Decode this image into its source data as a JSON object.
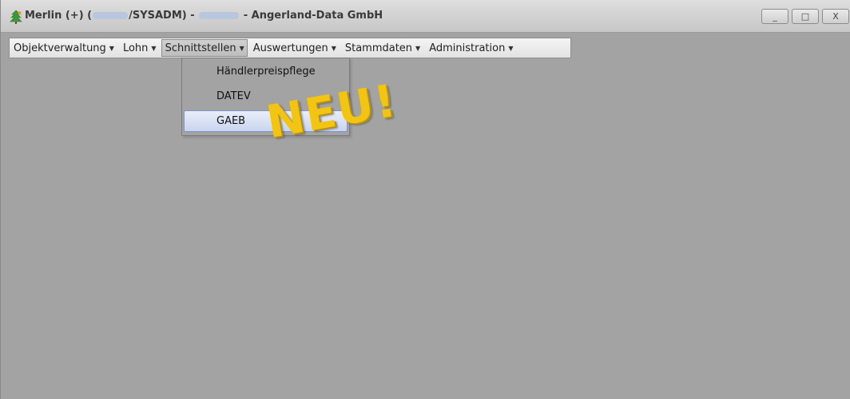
{
  "window": {
    "title_prefix": "Merlin (+) (",
    "title_user_suffix": "/SYSADM) -",
    "title_suffix": "- Angerland-Data GmbH",
    "controls": {
      "minimize": "_",
      "maximize": "□",
      "close": "X"
    }
  },
  "menubar": {
    "items": [
      {
        "label": "Objektverwaltung"
      },
      {
        "label": "Lohn"
      },
      {
        "label": "Schnittstellen"
      },
      {
        "label": "Auswertungen"
      },
      {
        "label": "Stammdaten"
      },
      {
        "label": "Administration"
      }
    ],
    "active_index": 2,
    "arrow": "▼"
  },
  "dropdown": {
    "items": [
      {
        "label": "Händlerpreispflege"
      },
      {
        "label": "DATEV"
      },
      {
        "label": "GAEB"
      }
    ],
    "highlighted_index": 2
  },
  "overlay": {
    "stamp_text": "NEU!"
  },
  "colors": {
    "background": "#a3a3a3",
    "stamp": "#f2c414",
    "highlight": "#c9d5ef"
  },
  "icons": {
    "app": "merlin-tree-icon"
  }
}
